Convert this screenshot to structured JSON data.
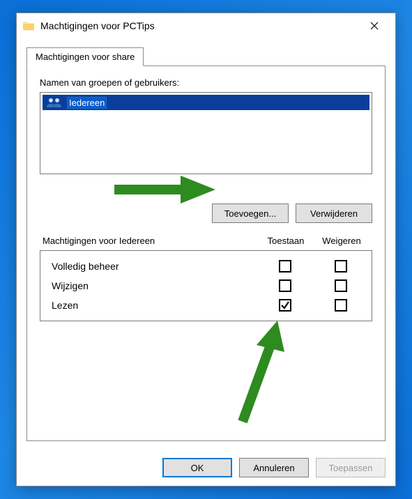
{
  "window": {
    "title": "Machtigingen voor PCTips"
  },
  "tab": {
    "label": "Machtigingen voor share"
  },
  "groupsSection": {
    "label": "Namen van groepen of gebruikers:",
    "items": [
      {
        "name": "Iedereen",
        "selected": true
      }
    ]
  },
  "buttons": {
    "add": "Toevoegen...",
    "remove": "Verwijderen"
  },
  "permSection": {
    "header_label": "Machtigingen voor Iedereen",
    "col_allow": "Toestaan",
    "col_deny": "Weigeren",
    "rows": [
      {
        "label": "Volledig beheer",
        "allow": false,
        "deny": false
      },
      {
        "label": "Wijzigen",
        "allow": false,
        "deny": false
      },
      {
        "label": "Lezen",
        "allow": true,
        "deny": false
      }
    ]
  },
  "footer": {
    "ok": "OK",
    "cancel": "Annuleren",
    "apply": "Toepassen"
  },
  "colors": {
    "selection": "#0a3e9b",
    "arrow": "#2e8b1f"
  }
}
